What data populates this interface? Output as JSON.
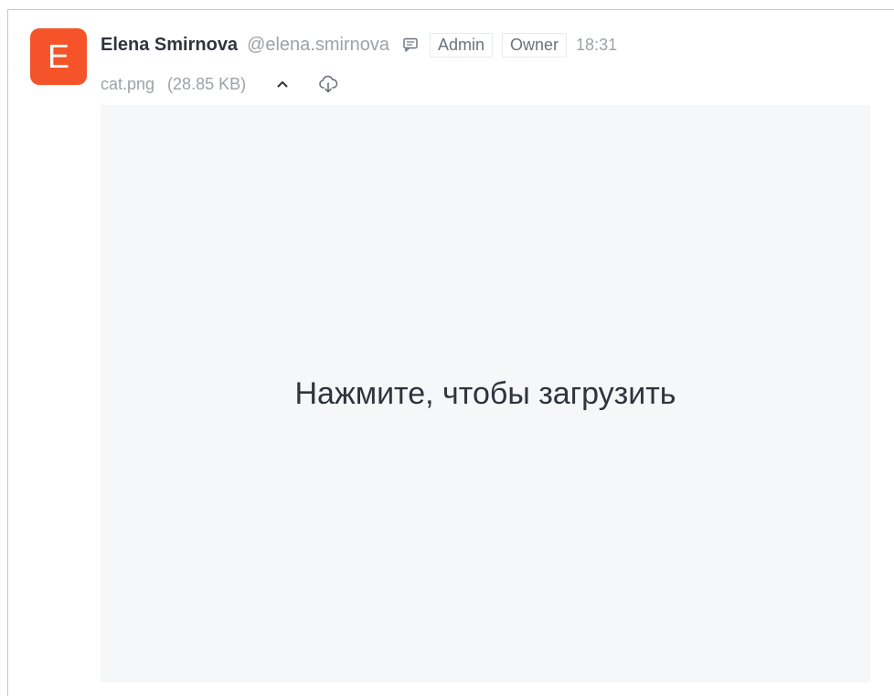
{
  "message": {
    "avatar_letter": "E",
    "author_name": "Elena Smirnova",
    "username": "@elena.smirnova",
    "roles": [
      "Admin",
      "Owner"
    ],
    "time": "18:31"
  },
  "attachment": {
    "file_name": "cat.png",
    "file_size": "(28.85 KB)",
    "collapse_icon": "chevron-up-icon",
    "download_icon": "cloud-download-icon",
    "preview_prompt": "Нажмите, чтобы загрузить"
  },
  "colors": {
    "avatar_bg": "#f5542a",
    "preview_bg": "#f6f7f9"
  }
}
